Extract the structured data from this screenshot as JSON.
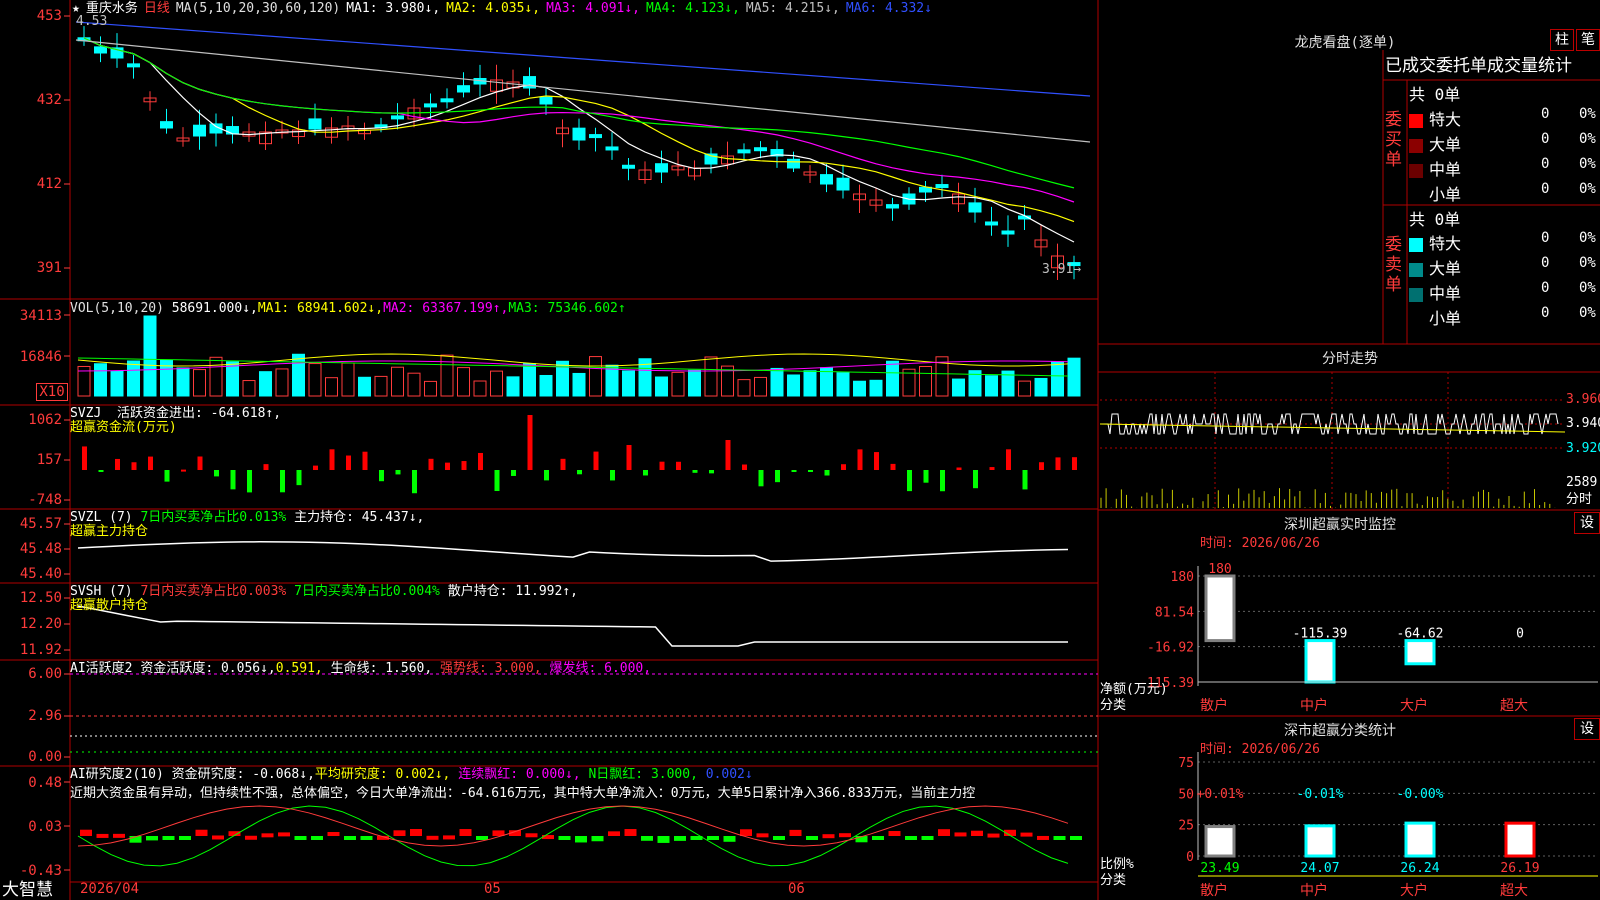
{
  "app": {
    "brand": "大智慧"
  },
  "header": {
    "stock_name": "重庆水务",
    "period": "日线",
    "ma_label": "MA(5,10,20,30,60,120)",
    "ma1": "MA1: 3.980↓,",
    "ma2": "MA2: 4.035↓,",
    "ma3": "MA3: 4.091↓,",
    "ma4": "MA4: 4.123↓,",
    "ma5": "MA5: 4.215↓,",
    "ma6": "MA6: 4.332↓",
    "high_marker": "4.53",
    "low_marker": "3.91→"
  },
  "price_axis": [
    "453",
    "432",
    "412",
    "391"
  ],
  "vol": {
    "title": "VOL(5,10,20)",
    "value": "58691.000↓,",
    "ma1": "MA1: 68941.602↓,",
    "ma2": "MA2: 63367.199↑,",
    "ma3": "MA3: 75346.602↑",
    "axis": [
      "34113",
      "16846",
      "X10"
    ]
  },
  "svzj": {
    "title": "SVZJ",
    "line1": "活跃资金进出: -64.618↑,",
    "line2": "超赢资金流(万元)",
    "axis": [
      "1062",
      "157",
      "-748"
    ]
  },
  "svzl": {
    "title": "SVZL (7)",
    "ratio": "7日内买卖净占比0.013%",
    "hold": "主力持仓: 45.437↓,",
    "line2": "超赢主力持仓",
    "axis": [
      "45.57",
      "45.48",
      "45.40"
    ]
  },
  "svsh": {
    "title": "SVSH (7)",
    "ratio1": "7日内买卖净占比0.003%",
    "ratio2": "7日内买卖净占比0.004%",
    "hold": "散户持仓: 11.992↑,",
    "line2": "超赢散户持仓",
    "axis": [
      "12.50",
      "12.20",
      "11.92"
    ]
  },
  "ai_active": {
    "title": "AI活跃度2",
    "v1": "资金活跃度: 0.056↓,",
    "v2": "0.591,",
    "v3": "生命线: 1.560,",
    "v4": "强势线: 3.000,",
    "v5": "爆发线: 6.000,",
    "axis": [
      "6.00",
      "2.96",
      "0.00"
    ]
  },
  "ai_research": {
    "title": "AI研究度2(10)",
    "v1": "资金研究度: -0.068↓,",
    "v2": "平均研究度: 0.002↓,",
    "v3": "连续飘红: 0.000↓,",
    "v4": "N日飘红: 3.000,",
    "v5": "0.002↓",
    "comment": "近期大资金虽有异动，但持续性不强，总体偏空，今日大单净流出：-64.616万元，其中特大单净流入：0万元，大单5日累计净入366.833万元，当前主力控",
    "axis": [
      "0.48",
      "0.03",
      "-0.43"
    ]
  },
  "x_axis": [
    "2026/04",
    "05",
    "06"
  ],
  "right": {
    "longhu_title": "龙虎看盘(逐单)",
    "btn_bar": "柱",
    "btn_pen": "笔",
    "tabs": [
      "已成交",
      "委托单",
      "成交量",
      "统计"
    ],
    "buy_label": "委买单",
    "sell_label": "委卖单",
    "buy_total": "共 0单",
    "sell_total": "共 0单",
    "buy_rows": [
      {
        "name": "特大",
        "count": "0",
        "pct": "0%",
        "color": "#ff0000"
      },
      {
        "name": "大单",
        "count": "0",
        "pct": "0%",
        "color": "#8b0000"
      },
      {
        "name": "中单",
        "count": "0",
        "pct": "0%",
        "color": "#6b0000"
      },
      {
        "name": "小单",
        "count": "0",
        "pct": "0%",
        "color": "#000000"
      }
    ],
    "sell_rows": [
      {
        "name": "特大",
        "count": "0",
        "pct": "0%",
        "color": "#00ffff"
      },
      {
        "name": "大单",
        "count": "0",
        "pct": "0%",
        "color": "#008b8b"
      },
      {
        "name": "中单",
        "count": "0",
        "pct": "0%",
        "color": "#007070"
      },
      {
        "name": "小单",
        "count": "0",
        "pct": "0%",
        "color": "#000000"
      }
    ],
    "intraday_title": "分时走势",
    "intraday_axis": [
      "3.960",
      "3.940",
      "3.920",
      "2589",
      "分时"
    ],
    "sz_title": "深圳超赢实时监控",
    "sz_btn": "设",
    "sz_time": "时间: 2026/06/26",
    "sz_axis": [
      "180",
      "81.54",
      "-16.92",
      "-115.39"
    ],
    "sz_ylabel": "净额(万元)",
    "sz_xlabel": "分类",
    "sz_cats": [
      "散户",
      "中户",
      "大户",
      "超大"
    ],
    "sz_vals_text": [
      "180",
      "-115.39",
      "-64.62",
      "0"
    ],
    "sm_title": "深市超赢分类统计",
    "sm_btn": "设",
    "sm_time": "时间: 2026/06/26",
    "sm_axis": [
      "75",
      "50",
      "25",
      "0"
    ],
    "sm_ylabel": "比例%",
    "sm_xlabel": "分类",
    "sm_cats": [
      "散户",
      "中户",
      "大户",
      "超大"
    ],
    "sm_top": [
      "+0.01%",
      "-0.01%",
      "-0.00%",
      ""
    ],
    "sm_bottom": [
      "23.49",
      "24.07",
      "26.24",
      "26.19"
    ]
  },
  "chart_data": [
    {
      "type": "bar",
      "title": "深圳超赢实时监控",
      "ylabel": "净额(万元)",
      "categories": [
        "散户",
        "中户",
        "大户",
        "超大"
      ],
      "values": [
        180,
        -115.39,
        -64.62,
        0
      ],
      "ylim": [
        -115.39,
        180
      ]
    },
    {
      "type": "bar",
      "title": "深市超赢分类统计",
      "ylabel": "比例%",
      "categories": [
        "散户",
        "中户",
        "大户",
        "超大"
      ],
      "values": [
        23.49,
        24.07,
        26.24,
        26.19
      ],
      "ylim": [
        0,
        75
      ]
    }
  ],
  "colors": {
    "up": "#ff3b3b",
    "down": "#00ffff",
    "bg": "#000000",
    "grid": "#b00000"
  }
}
